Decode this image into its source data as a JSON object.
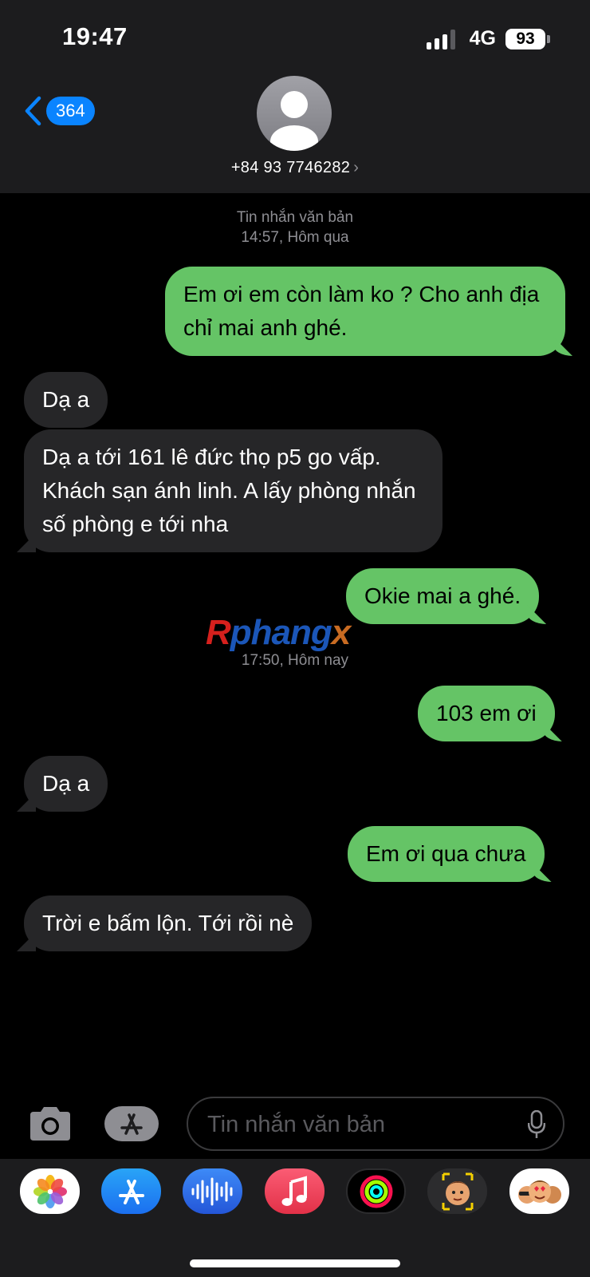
{
  "status_bar": {
    "time": "19:47",
    "network": "4G",
    "battery": "93"
  },
  "header": {
    "back_badge": "364",
    "contact_number": "+84 93 7746282",
    "chevron": "›"
  },
  "thread": {
    "timestamp_1_label": "Tin nhắn văn bản",
    "timestamp_1_time": "14:57, Hôm qua",
    "timestamp_2_time": "17:50, Hôm nay",
    "messages": [
      {
        "direction": "outgoing",
        "text": "Em ơi em còn làm ko ? Cho anh địa chỉ mai anh ghé."
      },
      {
        "direction": "incoming",
        "text": "Dạ a"
      },
      {
        "direction": "incoming",
        "text": "Dạ a tới 161 lê đức thọ p5 go vấp. Khách sạn ánh linh. A lấy phòng nhắn số phòng e tới nha"
      },
      {
        "direction": "outgoing",
        "text": "Okie mai a ghé."
      },
      {
        "direction": "outgoing",
        "text": "103 em ơi"
      },
      {
        "direction": "incoming",
        "text": "Dạ a"
      },
      {
        "direction": "outgoing",
        "text": "Em ơi qua chưa"
      },
      {
        "direction": "incoming",
        "text": "Trời e bấm lộn. Tới rồi nè"
      }
    ]
  },
  "watermark": {
    "part_1": "R",
    "part_2": "phang",
    "part_3": "x"
  },
  "input_bar": {
    "placeholder": "Tin nhắn văn bản",
    "camera_icon": "camera-icon",
    "apps_icon": "app-store-icon",
    "mic_icon": "microphone-icon"
  },
  "app_drawer": {
    "apps": [
      "photos-app-icon",
      "app-store-app-icon",
      "audio-message-app-icon",
      "music-app-icon",
      "activity-app-icon",
      "memoji-app-icon",
      "memoji-stickers-app-icon"
    ]
  },
  "colors": {
    "outgoing_bubble": "#65c466",
    "incoming_bubble": "#262628",
    "accent": "#0a84ff",
    "header_bg": "#1c1c1e"
  }
}
